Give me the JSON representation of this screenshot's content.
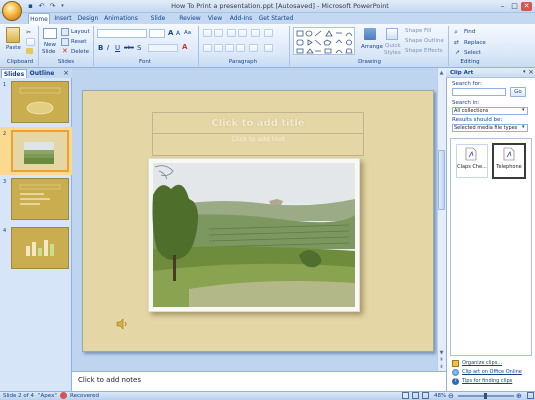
{
  "window": {
    "title": "How To Print a presentation.ppt [Autosaved] - Microsoft PowerPoint",
    "controls": [
      "–",
      "□",
      "✕"
    ]
  },
  "ribbon": {
    "tabs": [
      "Home",
      "Insert",
      "Design",
      "Animations",
      "Slide Show",
      "Review",
      "View",
      "Add-Ins",
      "Get Started"
    ],
    "active_tab": "Home",
    "clipboard": {
      "paste": "Paste",
      "group": "Clipboard"
    },
    "slides": {
      "new_slide": "New",
      "new_slide2": "Slide",
      "layout": "Layout",
      "reset": "Reset",
      "delete": "Delete",
      "group": "Slides"
    },
    "font": {
      "group": "Font",
      "bold": "B",
      "italic": "I",
      "underline": "U",
      "strike": "abc",
      "shadow": "S",
      "grow": "A",
      "shrink": "A",
      "clear": "Aa",
      "color": "A"
    },
    "paragraph": {
      "group": "Paragraph"
    },
    "drawing": {
      "arrange": "Arrange",
      "quick_styles": "Quick",
      "quick_styles2": "Styles",
      "shape_fill": "Shape Fill",
      "shape_outline": "Shape Outline",
      "shape_effects": "Shape Effects",
      "group": "Drawing"
    },
    "editing": {
      "find": "Find",
      "replace": "Replace",
      "select": "Select",
      "group": "Editing"
    }
  },
  "left_panel": {
    "tabs": [
      "Slides",
      "Outline"
    ],
    "close": "×",
    "thumbnails": [
      {
        "number": "1",
        "selected": false
      },
      {
        "number": "2",
        "selected": true
      },
      {
        "number": "3",
        "selected": false
      },
      {
        "number": "4",
        "selected": false
      }
    ]
  },
  "slide": {
    "title_placeholder": "Click to add title",
    "text_placeholder": "Click to add text"
  },
  "notes": {
    "placeholder": "Click to add notes"
  },
  "task_pane": {
    "title": "Clip Art",
    "search_for_label": "Search for:",
    "search_for_value": "",
    "go_button": "Go",
    "search_in_label": "Search in:",
    "search_in_value": "All collections",
    "results_label": "Results should be:",
    "results_value": "Selected media file types",
    "results": [
      {
        "label": "Claps Che...",
        "icon": "audio-file-icon"
      },
      {
        "label": "Telephone",
        "icon": "audio-file-icon"
      }
    ],
    "links": [
      "Organize clips...",
      "Clip art on Office Online",
      "Tips for finding clips"
    ]
  },
  "status_bar": {
    "slide_info": "Slide 2 of 4",
    "theme": "\"Apex\"",
    "recovered": "Recovered",
    "zoom": "48%"
  },
  "colors": {
    "ribbon_blue": "#c4d8f1",
    "slide_background": "#e4d6a5",
    "thumbnail_gold": "#c9ad4e",
    "selected_orange": "#f0a030"
  }
}
